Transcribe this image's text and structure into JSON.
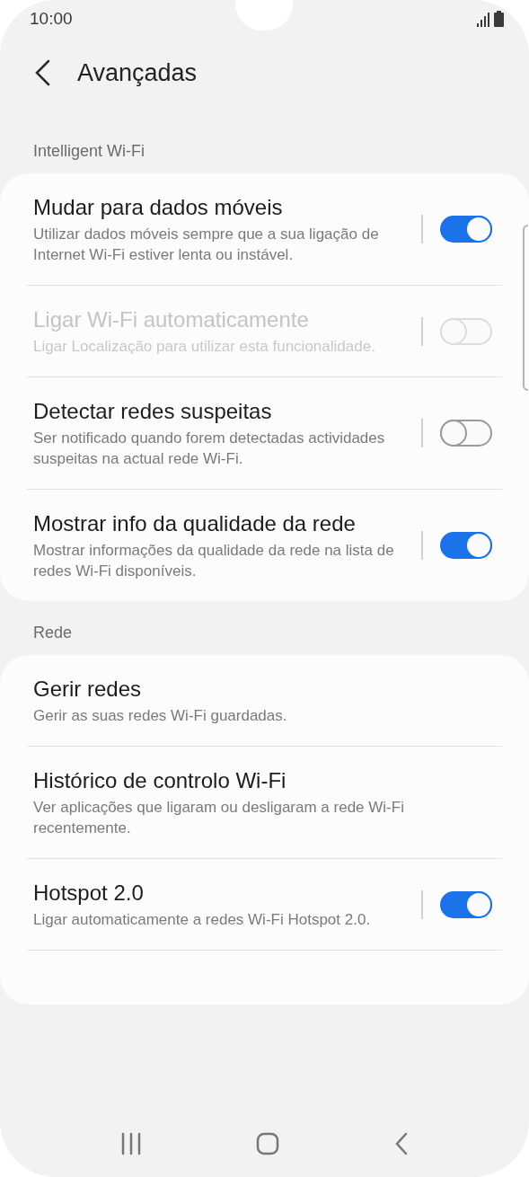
{
  "status_bar": {
    "time": "10:00"
  },
  "header": {
    "title": "Avançadas"
  },
  "sections": [
    {
      "title": "Intelligent Wi-Fi",
      "items": [
        {
          "kind": "toggle",
          "title": "Mudar para dados móveis",
          "subtitle": "Utilizar dados móveis sempre que a sua ligação de Internet Wi-Fi estiver lenta ou instável.",
          "on": true,
          "disabled": false
        },
        {
          "kind": "toggle",
          "title": "Ligar Wi-Fi automaticamente",
          "subtitle": "Ligar Localização para utilizar esta funcionalidade.",
          "on": false,
          "disabled": true
        },
        {
          "kind": "toggle",
          "title": "Detectar redes suspeitas",
          "subtitle": "Ser notificado quando forem detectadas actividades suspeitas na actual rede Wi-Fi.",
          "on": false,
          "disabled": false
        },
        {
          "kind": "toggle",
          "title": "Mostrar info da qualidade da rede",
          "subtitle": "Mostrar informações da qualidade da rede na lista de redes Wi-Fi disponíveis.",
          "on": true,
          "disabled": false
        }
      ]
    },
    {
      "title": "Rede",
      "items": [
        {
          "kind": "link",
          "title": "Gerir redes",
          "subtitle": "Gerir as suas redes Wi-Fi guardadas."
        },
        {
          "kind": "link",
          "title": "Histórico de controlo Wi-Fi",
          "subtitle": "Ver aplicações que ligaram ou desligaram a rede Wi-Fi recentemente."
        },
        {
          "kind": "toggle",
          "title": "Hotspot 2.0",
          "subtitle": "Ligar automaticamente a redes Wi-Fi Hotspot 2.0.",
          "on": true,
          "disabled": false
        }
      ]
    }
  ]
}
